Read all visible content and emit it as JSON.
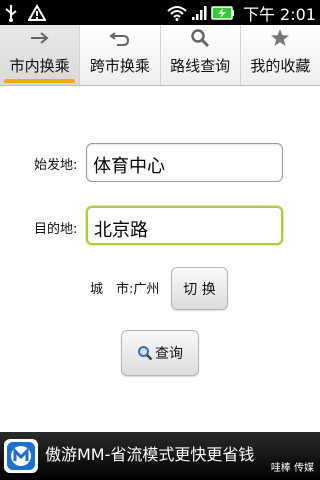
{
  "status_bar": {
    "time": "下午 2:01",
    "icons": [
      "usb-icon",
      "warning-icon",
      "wifi-icon",
      "signal-icon",
      "battery-charging-icon"
    ]
  },
  "tabs": [
    {
      "label": "市内换乘",
      "icon": "arrow-right-icon",
      "active": true
    },
    {
      "label": "跨市换乘",
      "icon": "return-arrow-icon",
      "active": false
    },
    {
      "label": "路线查询",
      "icon": "search-icon",
      "active": false
    },
    {
      "label": "我的收藏",
      "icon": "star-icon",
      "active": false
    }
  ],
  "form": {
    "origin_label": "始发地:",
    "origin_value": "体育中心",
    "destination_label": "目的地:",
    "destination_value": "北京路",
    "city_label": "城　市:",
    "city_value": "广州",
    "switch_label": "切 换",
    "search_label": "查询"
  },
  "ad": {
    "text": "傲游MM-省流模式更快更省钱",
    "brand": "哇棒 传媒"
  },
  "colors": {
    "accent": "#f2a900",
    "focus": "#a6cf3a"
  }
}
